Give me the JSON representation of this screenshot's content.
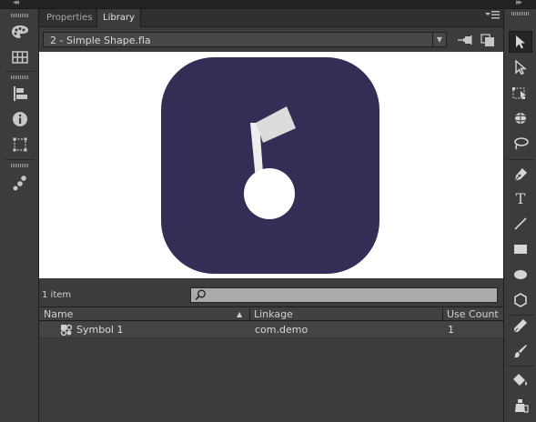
{
  "panel": {
    "tabs": [
      {
        "label": "Properties",
        "active": false
      },
      {
        "label": "Library",
        "active": true
      }
    ],
    "menu_icon": "panel-menu-icon"
  },
  "library": {
    "document_selector": "2 - Simple Shape.fla",
    "item_count": "1 item",
    "search": {
      "value": "",
      "placeholder": ""
    },
    "columns": [
      "Name",
      "Linkage",
      "Use Count"
    ],
    "sort": {
      "column": "Name",
      "direction": "ascending"
    },
    "items": [
      {
        "name": "Symbol 1",
        "linkage": "com.demo",
        "use_count": "1",
        "icon": "movie-clip-icon"
      }
    ]
  },
  "preview_colors": {
    "background": "#ffffff",
    "shape_fill": "#352d55",
    "shape_edge": "#e9617a",
    "note": "#ffffff"
  },
  "left_tools": [
    "color-palette-icon",
    "swatches-grid-icon",
    "align-icon",
    "info-icon",
    "transform-icon",
    "components-icon"
  ],
  "right_tools": [
    "selection-tool-icon",
    "subselection-tool-icon",
    "free-transform-tool-icon",
    "3d-rotation-tool-icon",
    "lasso-tool-icon",
    "pen-tool-icon",
    "text-tool-icon",
    "line-tool-icon",
    "rectangle-tool-icon",
    "oval-tool-icon",
    "polystar-tool-icon",
    "pencil-tool-icon",
    "brush-tool-icon",
    "paint-bucket-tool-icon",
    "ink-bottle-tool-icon"
  ],
  "tool_text_glyph": "T"
}
